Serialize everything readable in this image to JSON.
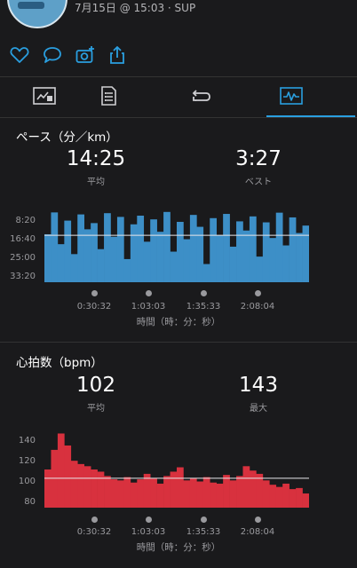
{
  "header": {
    "meta": "7月15日 @ 15:03 · SUP"
  },
  "actions": {
    "icons": [
      "heart-icon",
      "comment-icon",
      "add-photo-icon",
      "share-icon"
    ],
    "accent": "#2a9fe0"
  },
  "tabs": [
    {
      "icon": "summary-chart-icon",
      "active": false
    },
    {
      "icon": "details-document-icon",
      "active": false
    },
    {
      "icon": "laps-loop-icon",
      "active": false
    },
    {
      "icon": "graph-icon",
      "active": true
    }
  ],
  "pace": {
    "title": "ペース（分／km）",
    "avg_value": "14:25",
    "avg_label": "平均",
    "best_value": "3:27",
    "best_label": "ベスト",
    "y_ticks": [
      "8:20",
      "16:40",
      "25:00",
      "33:20"
    ],
    "x_ticks": [
      "0:30:32",
      "1:03:03",
      "1:35:33",
      "2:08:04"
    ],
    "x_title": "時間（時：分：秒）",
    "color": "#3d8fc7"
  },
  "heart": {
    "title": "心拍数（bpm）",
    "avg_value": "102",
    "avg_label": "平均",
    "max_value": "143",
    "max_label": "最大",
    "y_ticks": [
      "140",
      "120",
      "100",
      "80"
    ],
    "x_ticks": [
      "0:30:32",
      "1:03:03",
      "1:35:33",
      "2:08:04"
    ],
    "x_title": "時間（時：分：秒）",
    "color": "#d8313e"
  },
  "chart_data": [
    {
      "type": "area",
      "title": "ペース（分／km）",
      "xlabel": "時間（時：分：秒）",
      "ylabel": "",
      "y_ticks": [
        "8:20",
        "16:40",
        "25:00",
        "33:20"
      ],
      "x_ticks": [
        "0:30:32",
        "1:03:03",
        "1:35:33",
        "2:08:04"
      ],
      "ylim_minutes_per_km": [
        33.33,
        4.0
      ],
      "average_minutes_per_km": 14.42,
      "series": [
        {
          "values": [
            14.0,
            5.2,
            18.0,
            8.5,
            22.0,
            6.0,
            12.0,
            9.5,
            20.0,
            5.5,
            15.0,
            7.0,
            24.0,
            10.0,
            6.5,
            17.0,
            8.0,
            13.0,
            5.0,
            21.0,
            9.0,
            16.0,
            6.2,
            11.0,
            26.0,
            7.5,
            14.5,
            5.8,
            19.0,
            8.8,
            12.5,
            6.8,
            23.0,
            9.2,
            15.5,
            5.3,
            18.5,
            7.2,
            13.5,
            10.5
          ]
        }
      ]
    },
    {
      "type": "area",
      "title": "心拍数（bpm）",
      "xlabel": "時間（時：分：秒）",
      "ylabel": "",
      "y_ticks": [
        80,
        100,
        120,
        140
      ],
      "x_ticks": [
        "0:30:32",
        "1:03:03",
        "1:35:33",
        "2:08:04"
      ],
      "ylim": [
        75,
        145
      ],
      "average": 102,
      "series": [
        {
          "values": [
            110,
            128,
            143,
            132,
            118,
            115,
            113,
            110,
            108,
            104,
            101,
            100,
            103,
            98,
            101,
            106,
            102,
            97,
            104,
            108,
            112,
            100,
            102,
            99,
            103,
            98,
            97,
            105,
            100,
            104,
            113,
            109,
            106,
            100,
            96,
            94,
            97,
            92,
            93,
            88
          ]
        }
      ]
    }
  ]
}
